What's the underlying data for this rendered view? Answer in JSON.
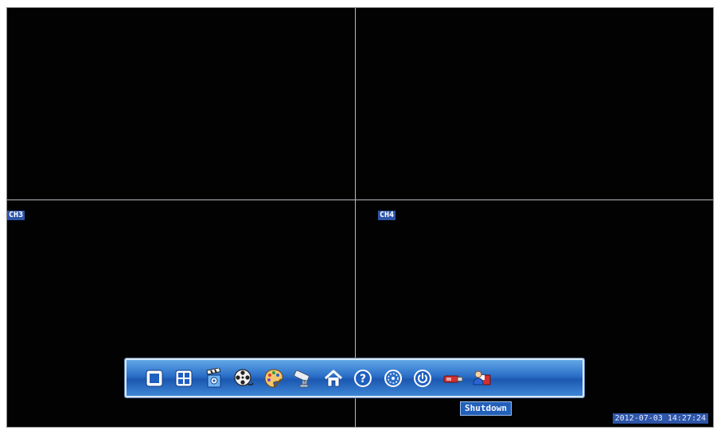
{
  "channels": [
    {
      "id": "ch1",
      "label": ""
    },
    {
      "id": "ch2",
      "label": ""
    },
    {
      "id": "ch3",
      "label": "CH3"
    },
    {
      "id": "ch4",
      "label": "CH4"
    }
  ],
  "taskbar": {
    "buttons": [
      {
        "icon": "single-view-icon"
      },
      {
        "icon": "quad-view-icon"
      },
      {
        "icon": "clapperboard-icon"
      },
      {
        "icon": "film-reel-icon"
      },
      {
        "icon": "color-palette-icon"
      },
      {
        "icon": "security-camera-icon"
      },
      {
        "icon": "home-icon"
      },
      {
        "icon": "help-icon"
      },
      {
        "icon": "settings-dial-icon"
      },
      {
        "icon": "power-icon"
      },
      {
        "icon": "usb-drive-icon"
      },
      {
        "icon": "user-login-icon"
      }
    ],
    "tooltip": "Shutdown"
  },
  "status": {
    "datetime": "2012-07-03 14:27:24"
  },
  "colors": {
    "taskbar_blue": "#2a6ec8",
    "label_blue": "#2d55a8",
    "divider": "#b9b9c4"
  }
}
